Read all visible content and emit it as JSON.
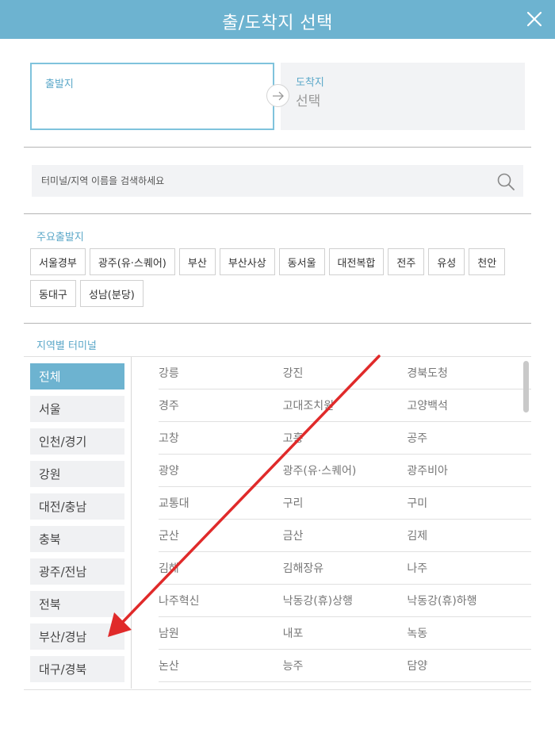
{
  "header": {
    "title": "출/도착지 선택"
  },
  "departure": {
    "label": "출발지",
    "value": ""
  },
  "arrival": {
    "label": "도착지",
    "value": "선택"
  },
  "search": {
    "placeholder": "터미널/지역 이름을 검색하세요"
  },
  "major_departures": {
    "title": "주요출발지",
    "items": [
      "서울경부",
      "광주(유·스퀘어)",
      "부산",
      "부산사상",
      "동서울",
      "대전복합",
      "전주",
      "유성",
      "천안",
      "동대구",
      "성남(분당)"
    ]
  },
  "regional": {
    "title": "지역별 터미널",
    "regions": [
      "전체",
      "서울",
      "인천/경기",
      "강원",
      "대전/충남",
      "충북",
      "광주/전남",
      "전북",
      "부산/경남",
      "대구/경북"
    ],
    "active_region": "전체",
    "terminals": [
      [
        "강릉",
        "강진",
        "경북도청"
      ],
      [
        "경주",
        "고대조치원",
        "고양백석"
      ],
      [
        "고창",
        "고흥",
        "공주"
      ],
      [
        "광양",
        "광주(유·스퀘어)",
        "광주비아"
      ],
      [
        "교통대",
        "구리",
        "구미"
      ],
      [
        "군산",
        "금산",
        "김제"
      ],
      [
        "김해",
        "김해장유",
        "나주"
      ],
      [
        "나주혁신",
        "낙동강(휴)상행",
        "낙동강(휴)하행"
      ],
      [
        "남원",
        "내포",
        "녹동"
      ],
      [
        "논산",
        "능주",
        "담양"
      ]
    ]
  },
  "colors": {
    "accent": "#6db3d0",
    "annotation": "#e02a2a"
  }
}
